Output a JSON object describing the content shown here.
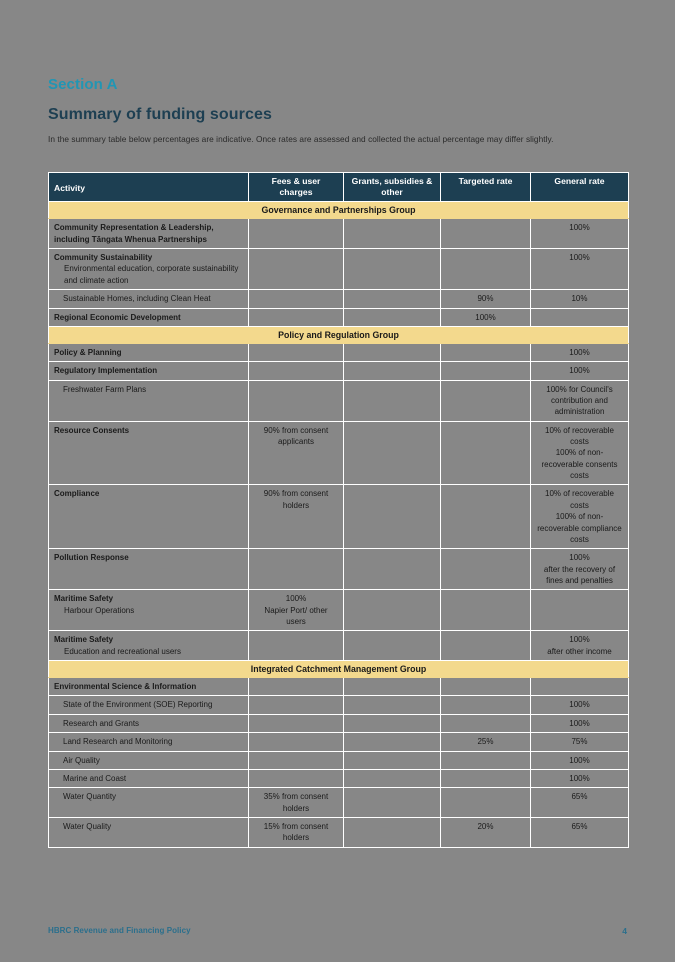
{
  "document": {
    "section_label": "Section A",
    "heading": "Summary of funding sources",
    "intro": "In the summary table below percentages are indicative. Once rates are assessed and collected the actual percentage may differ slightly.",
    "footer_text": "HBRC Revenue and Financing Policy",
    "page_number": "4",
    "colors": {
      "accent_teal": "#2196b4",
      "header_navy": "#1d3f52",
      "group_yellow": "#f3d98d",
      "page_background": "#878787",
      "footer_blue": "#2b6f8c"
    }
  },
  "table": {
    "headers": {
      "activity": "Activity",
      "fees": "Fees & user charges",
      "grants": "Grants, subsidies & other",
      "targeted": "Targeted rate",
      "general": "General rate"
    },
    "groups": [
      {
        "name": "Governance and Partnerships Group",
        "rows": [
          {
            "activity": "Community Representation & Leadership, including Tāngata Whenua Partnerships",
            "style": "bold",
            "fees": "",
            "grants": "",
            "targeted": "",
            "general": "100%"
          },
          {
            "activity": "Community Sustainability",
            "style": "bold",
            "sub": "Environmental education, corporate sustainability and climate action",
            "fees": "",
            "grants": "",
            "targeted": "",
            "general": "100%"
          },
          {
            "activity": "Sustainable Homes, including Clean Heat",
            "style": "indent",
            "fees": "",
            "grants": "",
            "targeted": "90%",
            "general": "10%"
          },
          {
            "activity": "Regional Economic Development",
            "style": "bold",
            "fees": "",
            "grants": "",
            "targeted": "100%",
            "general": ""
          }
        ]
      },
      {
        "name": "Policy and Regulation Group",
        "rows": [
          {
            "activity": "Policy & Planning",
            "style": "bold",
            "fees": "",
            "grants": "",
            "targeted": "",
            "general": "100%"
          },
          {
            "activity": "Regulatory Implementation",
            "style": "bold",
            "fees": "",
            "grants": "",
            "targeted": "",
            "general": "100%"
          },
          {
            "activity": "Freshwater Farm Plans",
            "style": "indent",
            "fees": "",
            "grants": "",
            "targeted": "",
            "general": "100% for Council's contribution and administration"
          },
          {
            "activity": "Resource Consents",
            "style": "bold",
            "fees": "90% from consent applicants",
            "grants": "",
            "targeted": "",
            "general": "10% of recoverable costs\n100% of non-recoverable consents costs"
          },
          {
            "activity": "Compliance",
            "style": "bold",
            "fees": "90% from consent holders",
            "grants": "",
            "targeted": "",
            "general": "10% of recoverable costs\n100% of non-recoverable compliance costs"
          },
          {
            "activity": "Pollution Response",
            "style": "bold",
            "fees": "",
            "grants": "",
            "targeted": "",
            "general": "100%\nafter the recovery of fines and penalties"
          },
          {
            "activity": "Maritime Safety",
            "style": "bold",
            "sub": "Harbour Operations",
            "fees": "100%\nNapier Port/ other users",
            "grants": "",
            "targeted": "",
            "general": ""
          },
          {
            "activity": "Maritime Safety",
            "style": "bold",
            "sub": "Education and recreational users",
            "fees": "",
            "grants": "",
            "targeted": "",
            "general": "100%\nafter other income"
          }
        ]
      },
      {
        "name": "Integrated Catchment Management Group",
        "rows": [
          {
            "activity": "Environmental Science & Information",
            "style": "bold",
            "fees": "",
            "grants": "",
            "targeted": "",
            "general": ""
          },
          {
            "activity": "State of the Environment (SOE) Reporting",
            "style": "indent",
            "fees": "",
            "grants": "",
            "targeted": "",
            "general": "100%"
          },
          {
            "activity": "Research and Grants",
            "style": "indent",
            "fees": "",
            "grants": "",
            "targeted": "",
            "general": "100%"
          },
          {
            "activity": "Land Research and Monitoring",
            "style": "indent",
            "fees": "",
            "grants": "",
            "targeted": "25%",
            "general": "75%"
          },
          {
            "activity": "Air Quality",
            "style": "indent",
            "fees": "",
            "grants": "",
            "targeted": "",
            "general": "100%"
          },
          {
            "activity": "Marine and Coast",
            "style": "indent",
            "fees": "",
            "grants": "",
            "targeted": "",
            "general": "100%"
          },
          {
            "activity": "Water Quantity",
            "style": "indent",
            "fees": "35% from consent holders",
            "grants": "",
            "targeted": "",
            "general": "65%"
          },
          {
            "activity": "Water Quality",
            "style": "indent",
            "fees": "15% from consent holders",
            "grants": "",
            "targeted": "20%",
            "general": "65%"
          }
        ]
      }
    ]
  }
}
